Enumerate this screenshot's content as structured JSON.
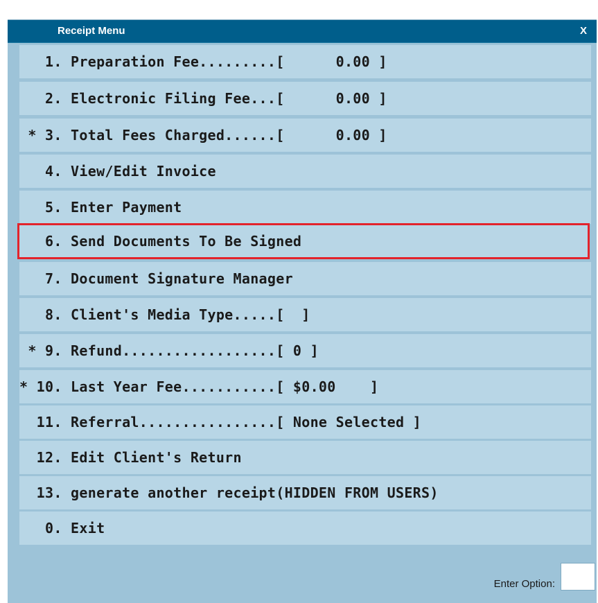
{
  "window": {
    "title": "Receipt Menu",
    "close_label": "X"
  },
  "menu": {
    "items": [
      {
        "text": "   1. Preparation Fee.........[      0.00 ]",
        "selected": false
      },
      {
        "text": "   2. Electronic Filing Fee...[      0.00 ]",
        "selected": false
      },
      {
        "text": " * 3. Total Fees Charged......[      0.00 ]",
        "selected": false
      },
      {
        "text": "   4. View/Edit Invoice",
        "selected": false
      },
      {
        "text": "   5. Enter Payment",
        "selected": false
      },
      {
        "text": "   6. Send Documents To Be Signed",
        "selected": true
      },
      {
        "text": "   7. Document Signature Manager",
        "selected": false
      },
      {
        "text": "   8. Client's Media Type.....[  ]",
        "selected": false
      },
      {
        "text": " * 9. Refund..................[ 0 ]",
        "selected": false
      },
      {
        "text": "* 10. Last Year Fee...........[ $0.00    ]",
        "selected": false
      },
      {
        "text": "  11. Referral................[ None Selected ]",
        "selected": false
      },
      {
        "text": "  12. Edit Client's Return",
        "selected": false
      },
      {
        "text": "  13. generate another receipt(HIDDEN FROM USERS)",
        "selected": false
      },
      {
        "text": "   0. Exit",
        "selected": false
      }
    ]
  },
  "footer": {
    "label": "Enter Option:",
    "input_value": ""
  },
  "colors": {
    "titlebar": "#005e8b",
    "window_bg": "#9dc3d8",
    "item_bg": "#b8d6e6",
    "highlight": "#e3232b"
  }
}
